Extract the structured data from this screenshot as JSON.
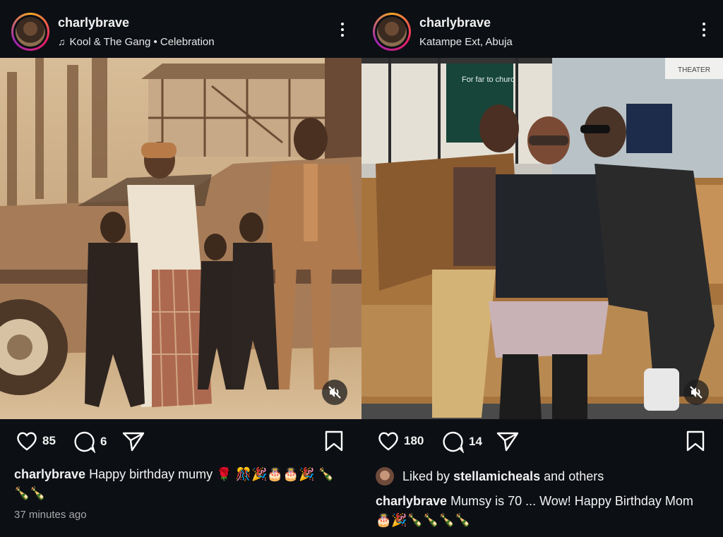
{
  "left_post": {
    "username": "charlybrave",
    "music": "Kool & The Gang • Celebration",
    "likes": "85",
    "comments": "6",
    "caption_user": "charlybrave",
    "caption_text": "Happy birthday mumy 🌹 🎊🎉🎂🎂🎉 🍾🍾🍾",
    "timestamp": "37 minutes ago"
  },
  "right_post": {
    "username": "charlybrave",
    "location": "Katampe Ext, Abuja",
    "likes": "180",
    "comments": "14",
    "liked_by_prefix": "Liked by",
    "liked_by_user": "stellamicheals",
    "liked_by_suffix": "and others",
    "caption_user": "charlybrave",
    "caption_text": "Mumsy is 70 ... Wow! Happy Birthday Mom 🎂🎉🍾🍾🍾🍾"
  },
  "photo_signs": {
    "church_sign": "For far to church",
    "theater_sign": "THEATER"
  },
  "icons": [
    "heart-icon",
    "comment-icon",
    "share-icon",
    "bookmark-icon",
    "more-icon",
    "mute-icon",
    "music-note-icon"
  ],
  "colors": {
    "background": "#0c0f14",
    "text": "#f2f2f2",
    "muted_text": "#a8a8a8"
  }
}
